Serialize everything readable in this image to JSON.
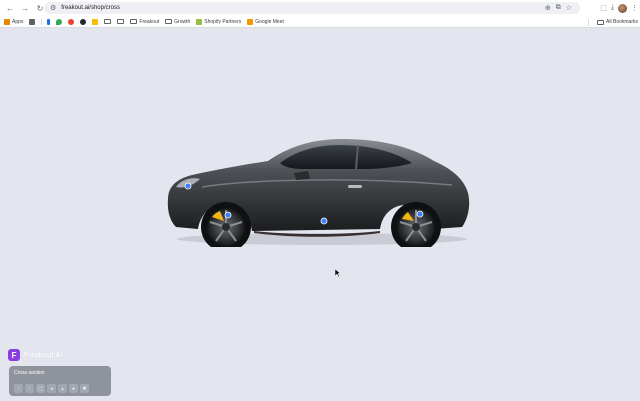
{
  "browser": {
    "url": "freakout.ai/shop/cross",
    "bookmarks": [
      {
        "label": "Apps",
        "color": "#ea8600",
        "icon": "apps-icon"
      },
      {
        "label": "",
        "color": "#5f6368",
        "icon": "tab-groups-icon"
      },
      {
        "label": "",
        "color": "#1a73e8",
        "icon": "bookmark-icon"
      },
      {
        "label": "",
        "color": "#34a853",
        "icon": "maps-icon"
      },
      {
        "label": "",
        "color": "#ea4335",
        "icon": "mail-icon"
      },
      {
        "label": "",
        "color": "#24292f",
        "icon": "github-icon"
      },
      {
        "label": "",
        "color": "#fbbc04",
        "icon": "drive-icon"
      },
      {
        "label": "",
        "color": "#5f6368",
        "icon": "folder-icon"
      },
      {
        "label": "",
        "color": "#5f6368",
        "icon": "folder-icon"
      }
    ],
    "folders": [
      {
        "label": "Freakout"
      },
      {
        "label": "Growth"
      }
    ],
    "shopify_label": "Shopify Partners",
    "meet_label": "Google Meet",
    "all_bookmarks_label": "All Bookmarks"
  },
  "freakout": {
    "brand_letter": "F",
    "brand_name": "Freakout AI",
    "panel_title": "Cross-section",
    "tools": [
      "‹",
      "›",
      "▢",
      "◂",
      "▴",
      "●",
      "✱"
    ]
  },
  "colors": {
    "stage_bg": "#e3e6ef",
    "accent": "#8b3ee0",
    "hotspot": "#3b82f6",
    "caliper": "#f2b417"
  }
}
